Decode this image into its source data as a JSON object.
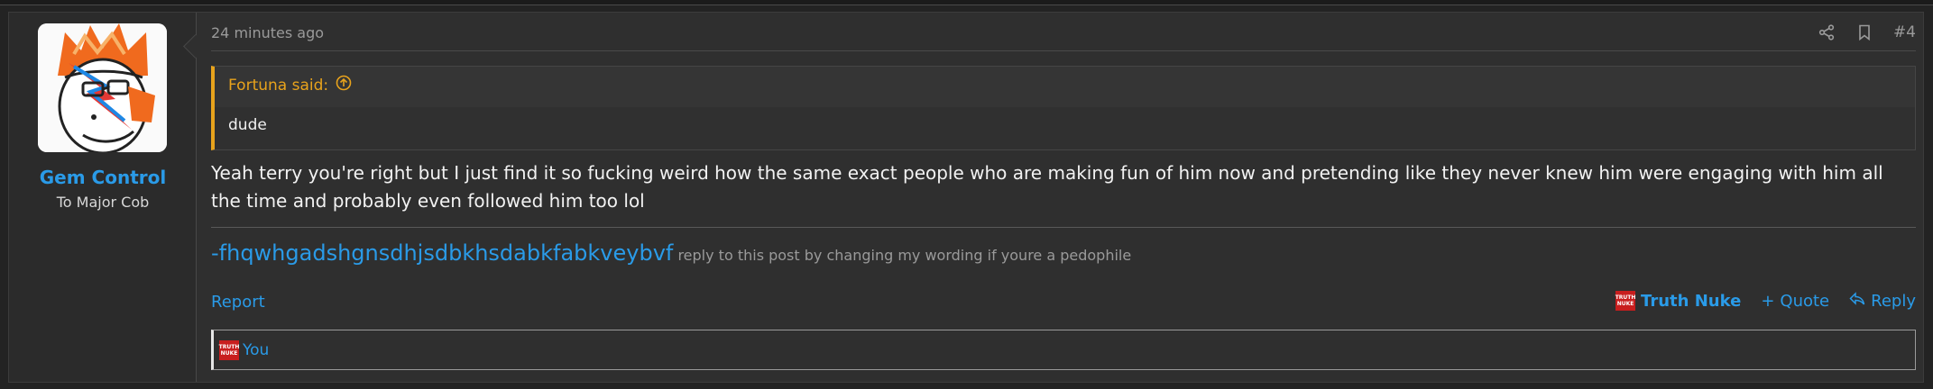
{
  "user": {
    "name": "Gem Control",
    "title": "To Major Cob"
  },
  "post": {
    "timestamp": "24 minutes ago",
    "number": "#4",
    "quote": {
      "author_label": "Fortuna said:",
      "body": "dude"
    },
    "message": "Yeah terry you're right but I just find it so fucking weird how the same exact people who are making fun of him now and pretending like they never knew him were engaging with him all the time and probably even followed him too lol",
    "signature": {
      "link_text": "-fhqwhgadshgnsdhjsdbkhsdabkfabkveybvf",
      "note": "reply to this post by changing my wording if youre a pedophile"
    }
  },
  "footer": {
    "report_label": "Report",
    "reaction_label": "Truth Nuke",
    "quote_label": "Quote",
    "reply_label": "Reply"
  },
  "reactions": {
    "who": "You"
  },
  "icons": {
    "share": "share-icon",
    "bookmark": "bookmark-icon",
    "quote_jump": "arrow-up-circle-icon",
    "reaction": "truth-nuke-icon",
    "plus": "plus-icon",
    "reply": "reply-icon"
  },
  "colors": {
    "link": "#2a9be8",
    "quote_accent": "#e8a31c",
    "background": "#2f2f2f"
  }
}
